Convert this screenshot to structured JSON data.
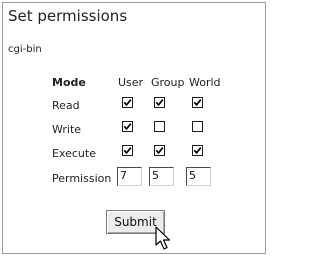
{
  "title": "Set permissions",
  "path": "cgi-bin",
  "headers": {
    "mode": "Mode",
    "user": "User",
    "group": "Group",
    "world": "World"
  },
  "rows": {
    "read": {
      "label": "Read",
      "user": true,
      "group": true,
      "world": true
    },
    "write": {
      "label": "Write",
      "user": true,
      "group": false,
      "world": false
    },
    "execute": {
      "label": "Execute",
      "user": true,
      "group": true,
      "world": true
    }
  },
  "permission": {
    "label": "Permission",
    "user": "7",
    "group": "5",
    "world": "5"
  },
  "submit_label": "Submit",
  "icons": {
    "checkmark": "checkmark-icon",
    "cursor": "mouse-pointer-icon"
  }
}
